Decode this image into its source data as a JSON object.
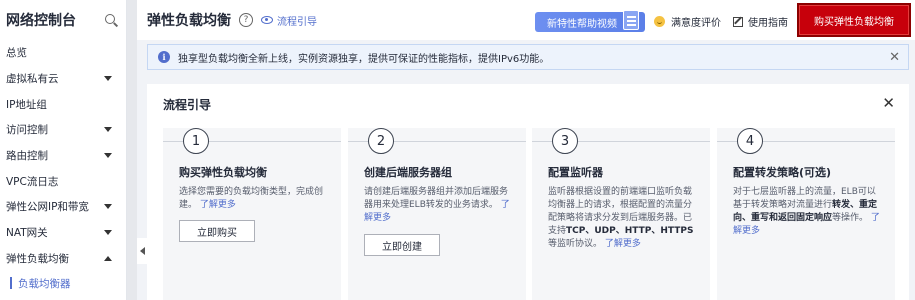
{
  "sidebar": {
    "title": "网络控制台",
    "items": [
      {
        "label": "总览",
        "caret": ""
      },
      {
        "label": "虚拟私有云",
        "caret": "down"
      },
      {
        "label": "IP地址组",
        "caret": ""
      },
      {
        "label": "访问控制",
        "caret": "down"
      },
      {
        "label": "路由控制",
        "caret": "down"
      },
      {
        "label": "VPC流日志",
        "caret": ""
      },
      {
        "label": "弹性公网IP和带宽",
        "caret": "down"
      },
      {
        "label": "NAT网关",
        "caret": "down"
      },
      {
        "label": "弹性负载均衡",
        "caret": "up"
      }
    ],
    "sub_item": "负载均衡器"
  },
  "header": {
    "title": "弹性负载均衡",
    "help": "?",
    "flow_link": "流程引导",
    "video_button": "新特性帮助视频",
    "rating": "满意度评价",
    "guide": "使用指南",
    "buy_button": "购买弹性负载均衡"
  },
  "notice": {
    "icon": "i",
    "text": "独享型负载均衡全新上线，实例资源独享，提供可保证的性能指标，提供IPv6功能。",
    "close": "✕"
  },
  "panel": {
    "title": "流程引导",
    "close": "✕",
    "steps": [
      {
        "num": "1",
        "title": "购买弹性负载均衡",
        "desc": "选择您需要的负载均衡类型，完成创建。",
        "link": "了解更多",
        "button": "立即购买"
      },
      {
        "num": "2",
        "title": "创建后端服务器组",
        "desc": "请创建后端服务器组并添加后端服务器用来处理ELB转发的业务请求。",
        "link": "了解更多",
        "button": "立即创建"
      },
      {
        "num": "3",
        "title": "配置监听器",
        "desc_a": "监听器根据设置的前端端口监听负载均衡器上的请求，根据配置的流量分配策略将请求分发到后端服务器。已支持",
        "desc_b": "TCP、UDP、HTTP、HTTPS",
        "desc_c": "等监听协议。",
        "link": "了解更多"
      },
      {
        "num": "4",
        "title": "配置转发策略(可选)",
        "desc_a": "对于七层监听器上的流量，ELB可以基于转发策略对流量进行",
        "desc_b": "转发、重定向、重写和返回固定响应",
        "desc_c": "等操作。",
        "link": "了解更多"
      }
    ]
  },
  "colors": {
    "accent": "#526ecc",
    "buy": "#c7000b"
  }
}
